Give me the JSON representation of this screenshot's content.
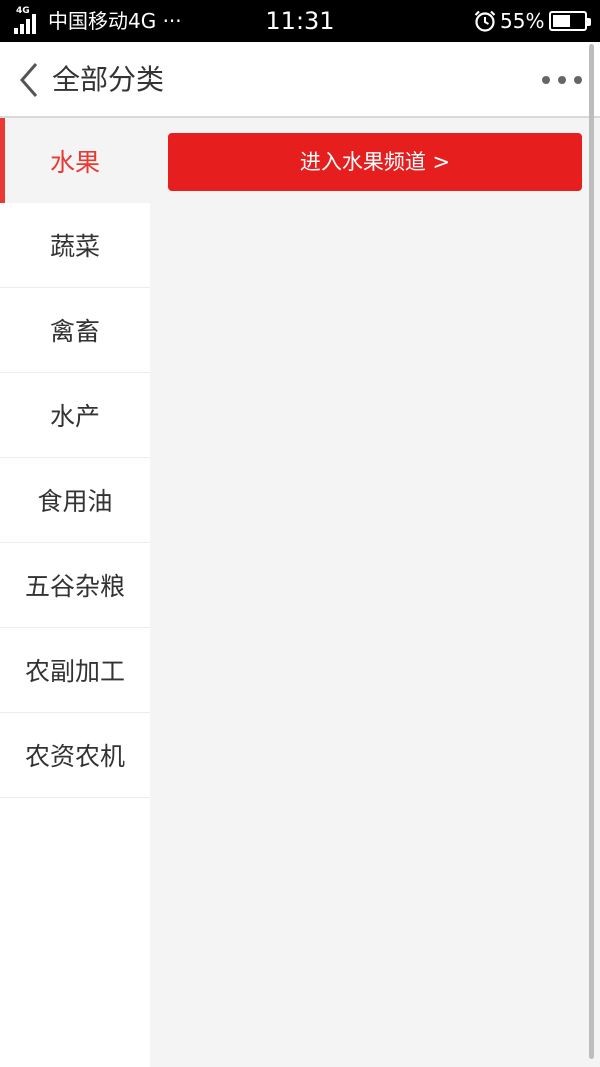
{
  "status_bar": {
    "network_tag": "4G",
    "carrier": "中国移动4G ···",
    "time": "11:31",
    "battery_percent_text": "55%",
    "battery_level": 0.55
  },
  "header": {
    "title": "全部分类"
  },
  "categories": [
    {
      "label": "水果",
      "active": true
    },
    {
      "label": "蔬菜"
    },
    {
      "label": "禽畜"
    },
    {
      "label": "水产"
    },
    {
      "label": "食用油"
    },
    {
      "label": "五谷杂粮"
    },
    {
      "label": "农副加工"
    },
    {
      "label": "农资农机"
    }
  ],
  "main": {
    "enter_button_label": "进入水果频道 >"
  },
  "colors": {
    "accent": "#e61e1e",
    "active_text": "#e83a32",
    "panel_bg": "#f4f4f4"
  }
}
